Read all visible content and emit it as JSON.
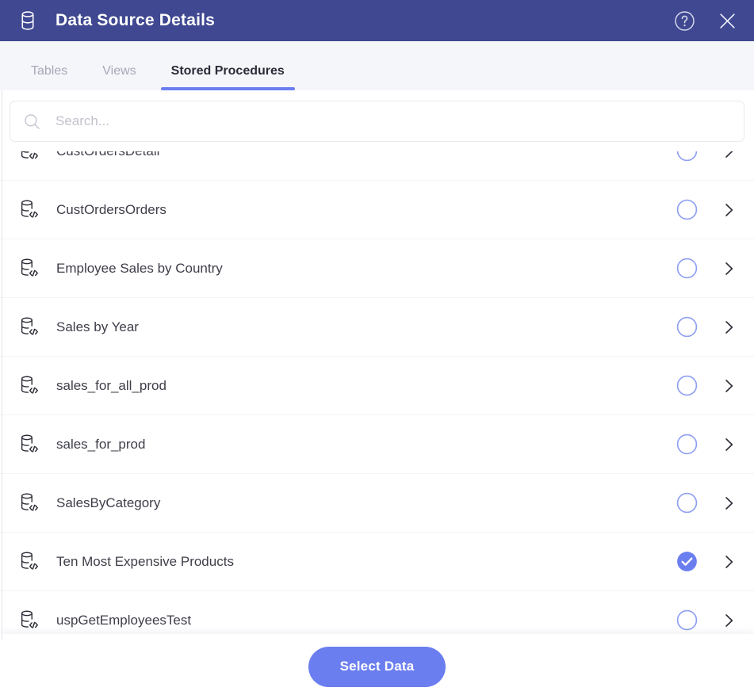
{
  "header": {
    "title": "Data Source Details",
    "db_icon": "database-icon",
    "help_icon": "help-circle-icon",
    "close_icon": "close-icon",
    "background_color": "#3f4890"
  },
  "tabs": {
    "items": [
      {
        "label": "Tables",
        "active": false
      },
      {
        "label": "Views",
        "active": false
      },
      {
        "label": "Stored Procedures",
        "active": true
      }
    ],
    "active_underline_color": "#6b7ef0"
  },
  "search": {
    "icon": "search-icon",
    "placeholder": "Search...",
    "value": ""
  },
  "list": {
    "item_icon": "stored-procedure-icon",
    "chevron_icon": "chevron-right-icon",
    "selected_color": "#6b7ef0",
    "unselected_color": "#8fa0f2",
    "items": [
      {
        "label": "CustOrdersDetail",
        "selected": false
      },
      {
        "label": "CustOrdersOrders",
        "selected": false
      },
      {
        "label": "Employee Sales by Country",
        "selected": false
      },
      {
        "label": "Sales by Year",
        "selected": false
      },
      {
        "label": "sales_for_all_prod",
        "selected": false
      },
      {
        "label": "sales_for_prod",
        "selected": false
      },
      {
        "label": "SalesByCategory",
        "selected": false
      },
      {
        "label": "Ten Most Expensive Products",
        "selected": true
      },
      {
        "label": "uspGetEmployeesTest",
        "selected": false
      }
    ]
  },
  "footer": {
    "select_data_label": "Select Data",
    "button_color": "#6b7ef0"
  }
}
